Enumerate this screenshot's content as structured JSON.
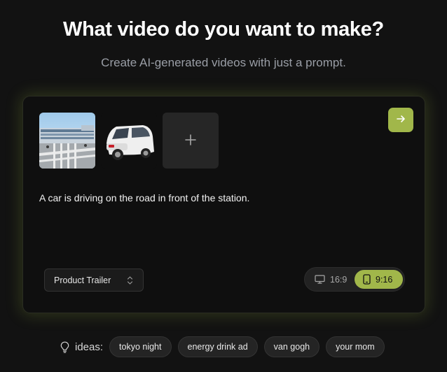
{
  "header": {
    "title": "What video do you want to make?",
    "subtitle": "Create AI-generated videos with just a prompt."
  },
  "composer": {
    "attachments": [
      {
        "name": "station-photo",
        "kind": "image"
      },
      {
        "name": "white-car-photo",
        "kind": "image"
      }
    ],
    "add_icon": "plus-icon",
    "submit_icon": "arrow-right-icon",
    "prompt_value": "A car is driving on the road in front of the station.",
    "style_select": {
      "selected": "Product Trailer",
      "icon": "chevron-up-down-icon"
    },
    "aspect_ratios": [
      {
        "label": "16:9",
        "icon": "monitor-icon",
        "selected": false
      },
      {
        "label": "9:16",
        "icon": "phone-icon",
        "selected": true
      }
    ]
  },
  "ideas": {
    "icon": "lightbulb-icon",
    "label": "ideas:",
    "chips": [
      "tokyo night",
      "energy drink ad",
      "van gogh",
      "your mom"
    ]
  },
  "colors": {
    "accent": "#a1b74a",
    "background": "#121212",
    "card": "#0f0f0f",
    "muted_text": "#9a9ea6"
  }
}
